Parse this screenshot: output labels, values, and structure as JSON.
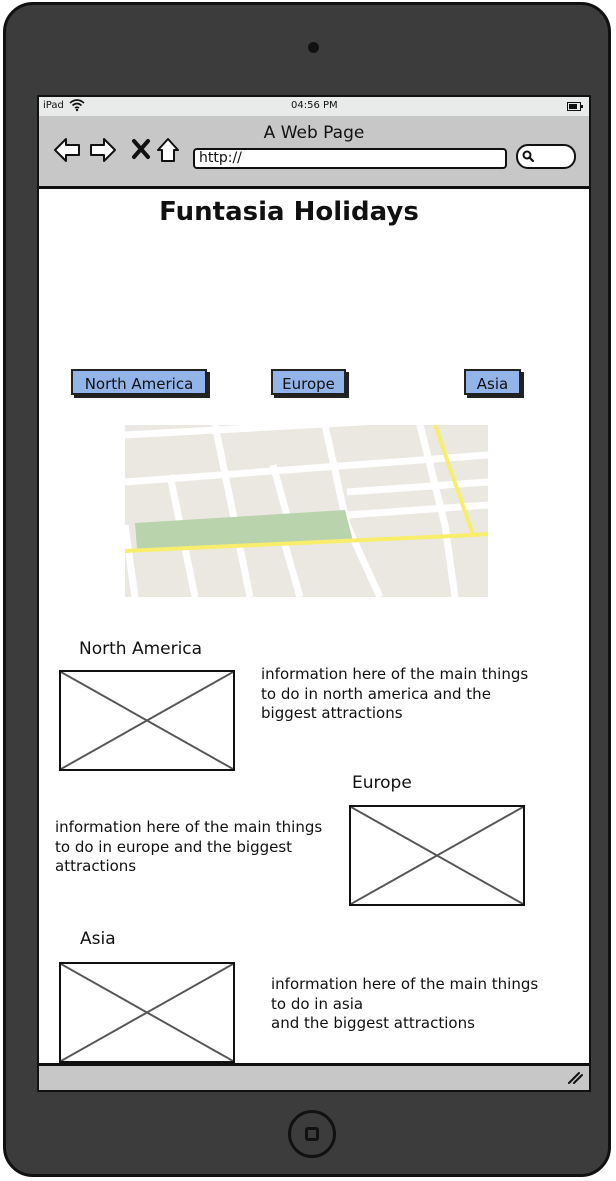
{
  "status_bar": {
    "carrier": "iPad",
    "time": "04:56 PM",
    "wifi_icon": "wifi-icon",
    "battery_icon": "battery-icon"
  },
  "browser": {
    "title": "A Web Page",
    "url": "http://",
    "icons": [
      "back-arrow-icon",
      "forward-arrow-icon",
      "close-icon",
      "home-icon",
      "search-icon"
    ]
  },
  "page": {
    "title": "Funtasia Holidays",
    "region_buttons": [
      "North America",
      "Europe",
      "Asia"
    ],
    "button_color": "#92b4e8",
    "sections": [
      {
        "heading": "North America",
        "info": "information here of the main things\nto do in north america and the\nbiggest attractions"
      },
      {
        "heading": "Europe",
        "info": "information here of the main things\nto do in europe and the biggest\nattractions"
      },
      {
        "heading": "Asia",
        "info": "information here of the main things\nto do in asia\nand the biggest attractions"
      }
    ]
  }
}
